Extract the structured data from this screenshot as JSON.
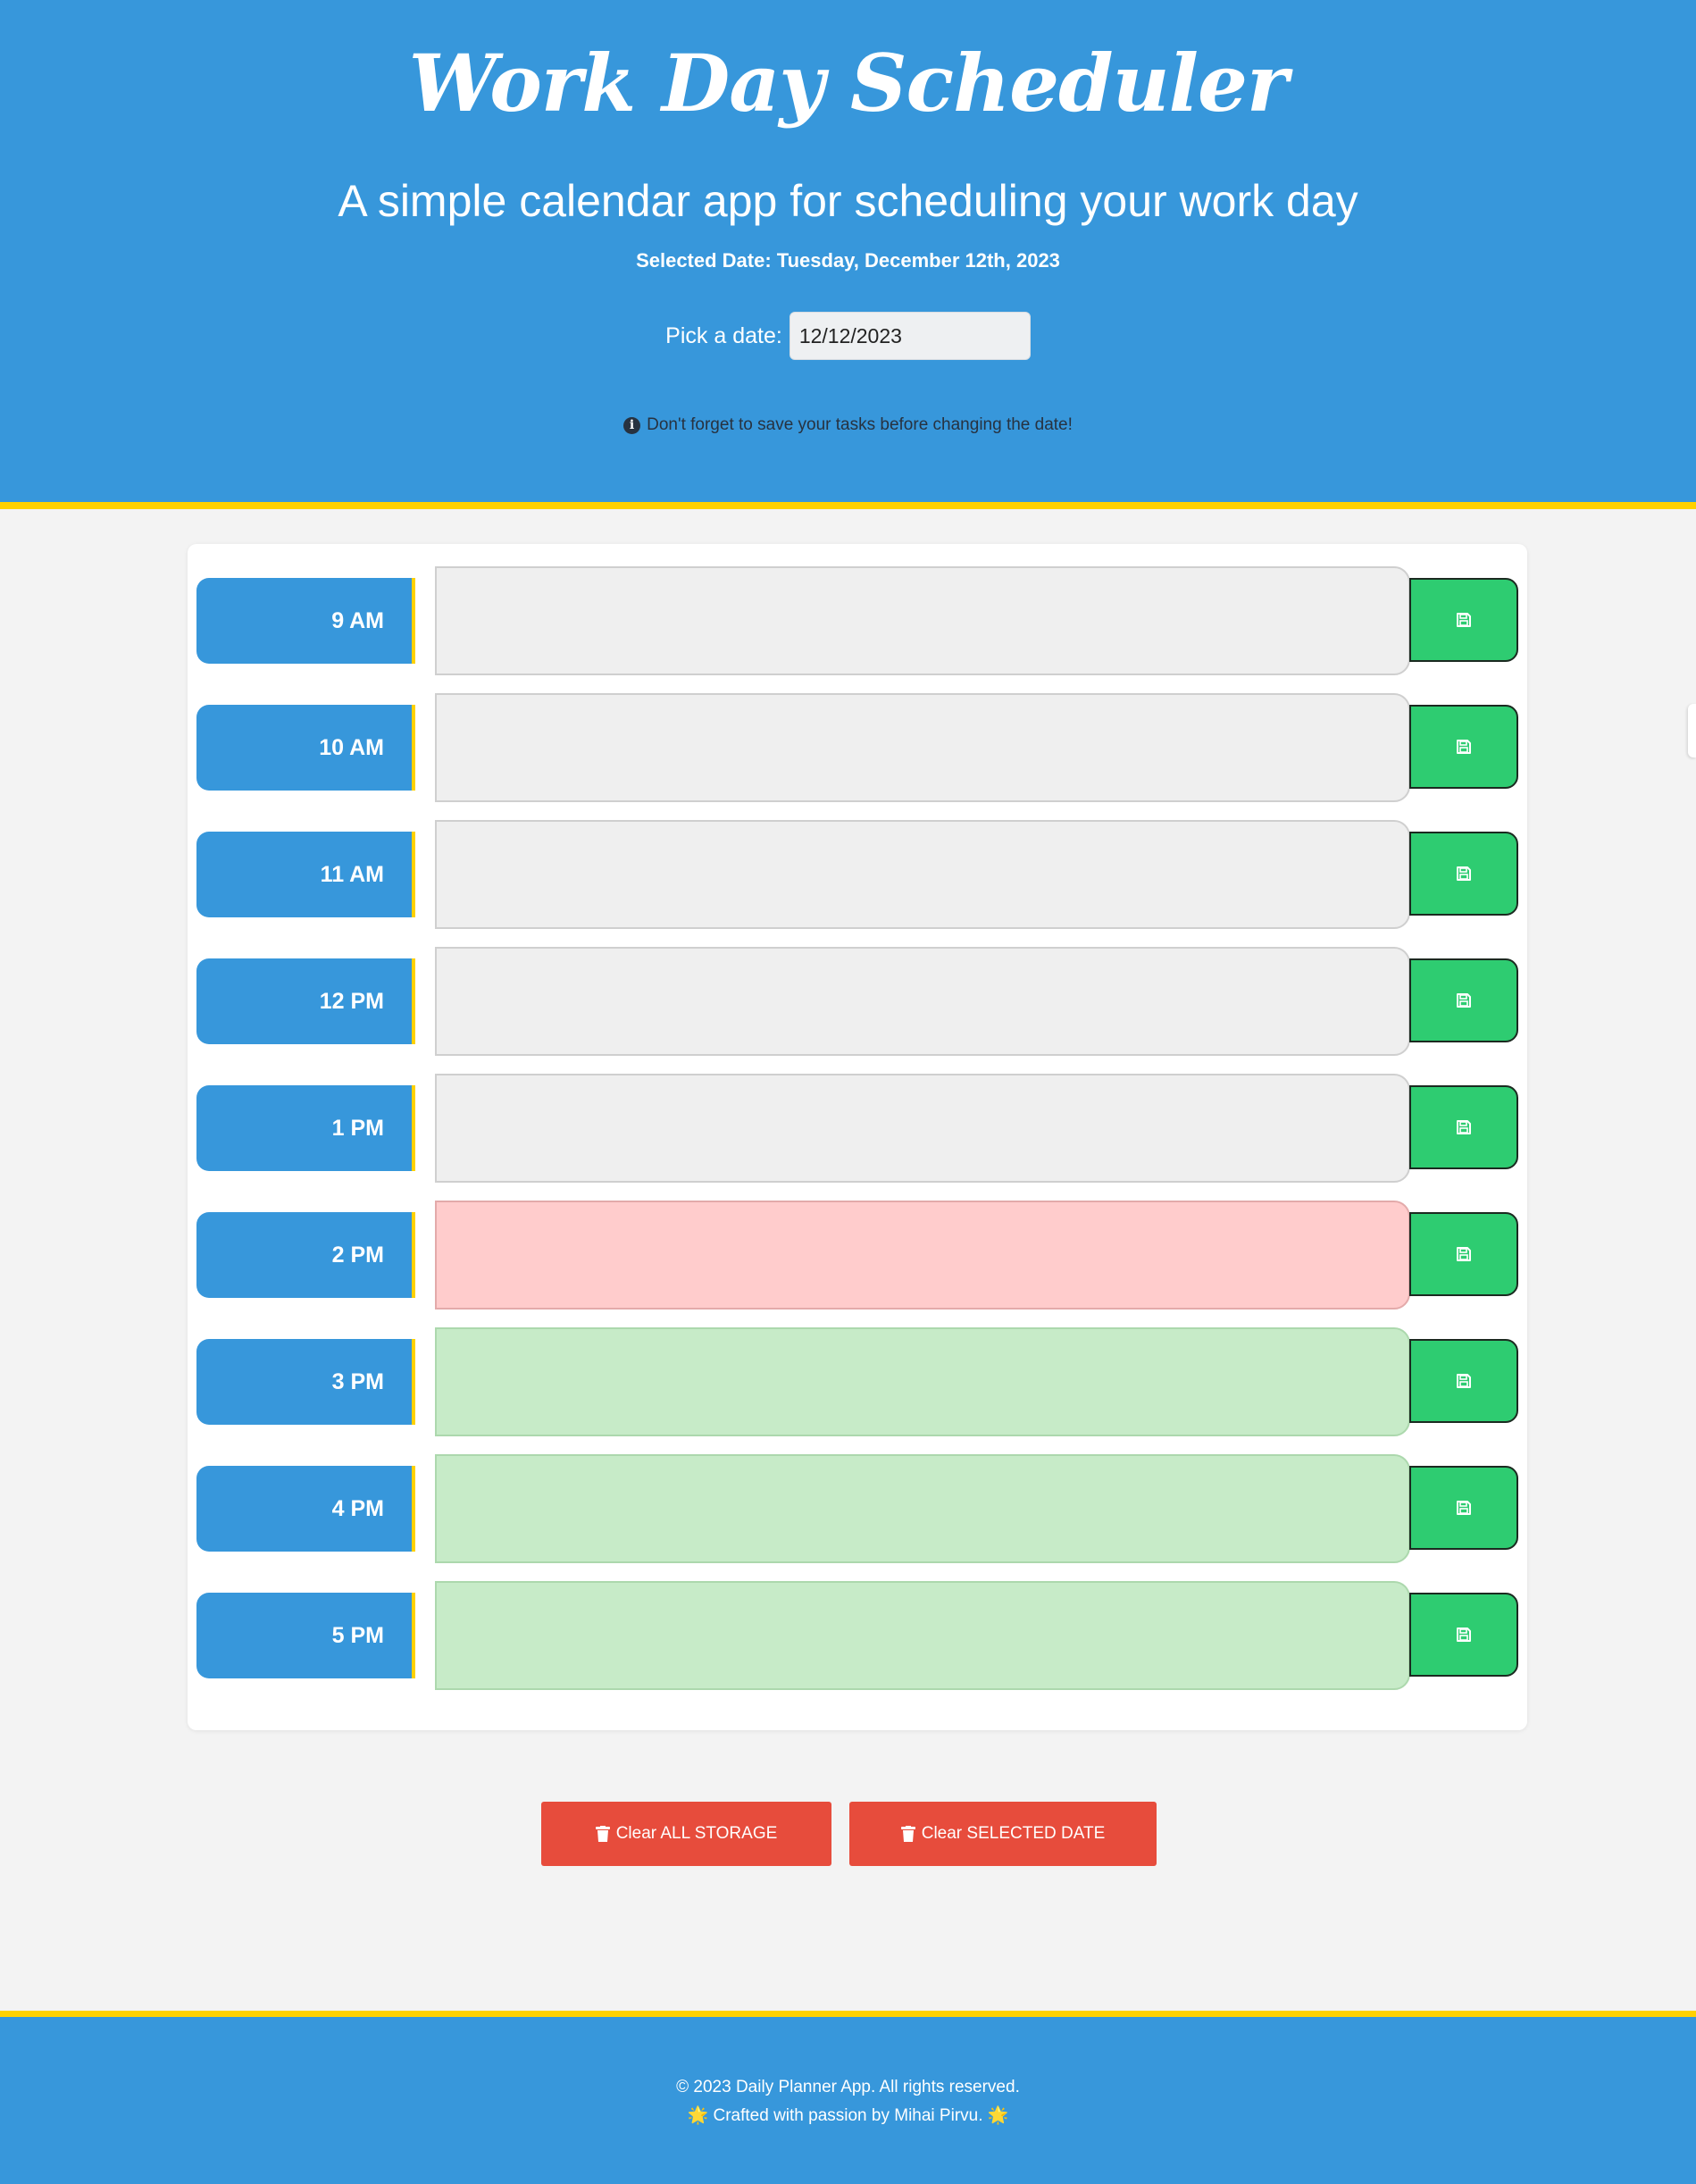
{
  "header": {
    "title": "Work Day Scheduler",
    "subtitle": "A simple calendar app for scheduling your work day",
    "selected_date": "Selected Date: Tuesday, December 12th, 2023",
    "date_label": "Pick a date:",
    "date_value": "12/12/2023",
    "reminder": "Don't forget to save your tasks before changing the date!",
    "reminder_icon": "info-circle-icon"
  },
  "colors": {
    "primary": "#3797db",
    "accent": "#ffd100",
    "past": "#efefef",
    "present": "#ffcccc",
    "future": "#c7ebc8",
    "save": "#2ecc71",
    "danger": "#e74c3c"
  },
  "schedule": {
    "save_icon": "floppy-disk-icon",
    "rows": [
      {
        "hour": "9 AM",
        "status": "past",
        "task": ""
      },
      {
        "hour": "10 AM",
        "status": "past",
        "task": ""
      },
      {
        "hour": "11 AM",
        "status": "past",
        "task": ""
      },
      {
        "hour": "12 PM",
        "status": "past",
        "task": ""
      },
      {
        "hour": "1 PM",
        "status": "past",
        "task": ""
      },
      {
        "hour": "2 PM",
        "status": "present",
        "task": ""
      },
      {
        "hour": "3 PM",
        "status": "future",
        "task": ""
      },
      {
        "hour": "4 PM",
        "status": "future",
        "task": ""
      },
      {
        "hour": "5 PM",
        "status": "future",
        "task": ""
      }
    ]
  },
  "actions": {
    "clear_all_label": "Clear ALL STORAGE",
    "clear_selected_label": "Clear SELECTED DATE",
    "trash_icon": "trash-icon"
  },
  "footer": {
    "copyright": "© 2023 Daily Planner App. All rights reserved.",
    "credit": "🌟 Crafted with passion by Mihai Pirvu. 🌟"
  }
}
